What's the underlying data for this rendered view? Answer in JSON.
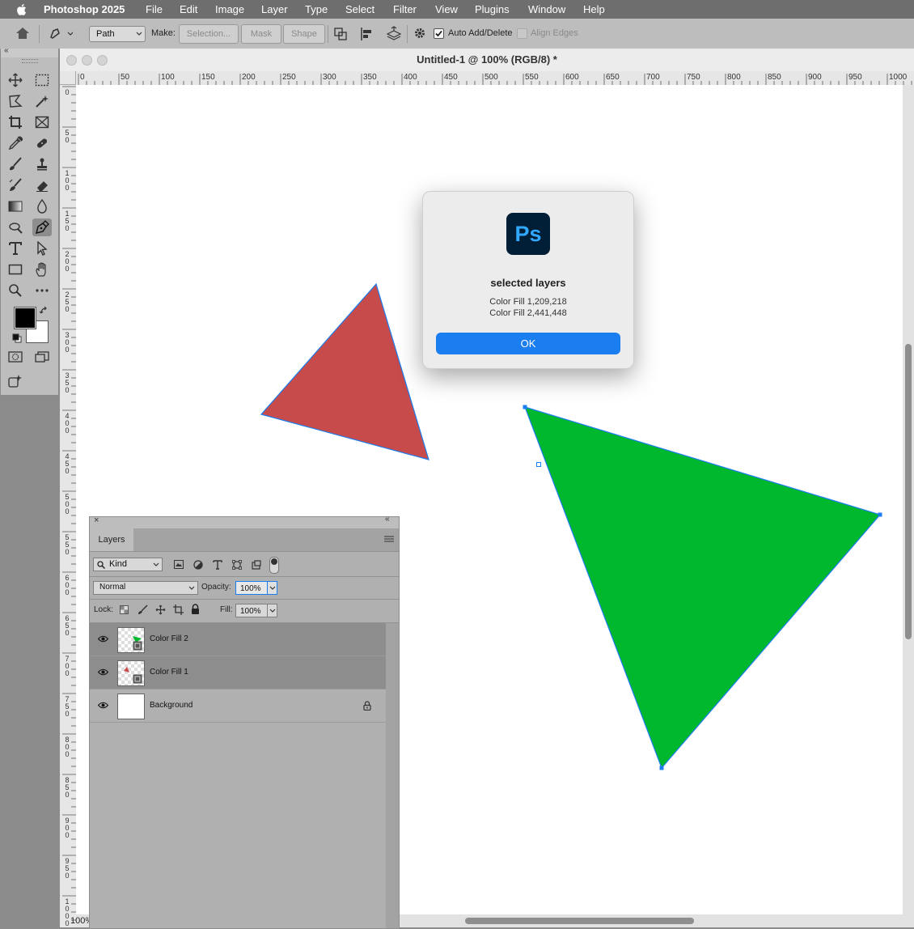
{
  "menubar": {
    "app_name": "Photoshop 2025",
    "items": [
      "File",
      "Edit",
      "Image",
      "Layer",
      "Type",
      "Select",
      "Filter",
      "View",
      "Plugins",
      "Window",
      "Help"
    ]
  },
  "options": {
    "mode_value": "Path",
    "make_label": "Make:",
    "selection_button": "Selection...",
    "mask_button": "Mask",
    "shape_button": "Shape",
    "auto_add_delete": "Auto Add/Delete",
    "auto_add_delete_checked": true,
    "align_edges": "Align Edges"
  },
  "document": {
    "title": "Untitled-1 @ 100% (RGB/8) *",
    "zoom": "100%",
    "hruler_labels": [
      "0",
      "50",
      "100",
      "150",
      "200",
      "250",
      "300",
      "350",
      "400",
      "450",
      "500",
      "550",
      "600",
      "650",
      "700",
      "750",
      "800",
      "850",
      "900",
      "950",
      "1000"
    ],
    "vruler_labels": [
      "0",
      "50",
      "100",
      "150",
      "200",
      "250",
      "300",
      "350",
      "400",
      "450",
      "500",
      "550",
      "600",
      "650",
      "700",
      "750",
      "800",
      "850",
      "900",
      "950",
      "1000"
    ]
  },
  "shapes": {
    "red_color": "#c84b4b",
    "green_color": "#00b82e",
    "path_color": "#1a7df0"
  },
  "dialog": {
    "title": "selected layers",
    "line1": "Color Fill 1,209,218",
    "line2": "Color Fill 2,441,448",
    "ok_label": "OK",
    "logo_text": "Ps"
  },
  "layers_panel": {
    "tab_label": "Layers",
    "kind_filter": "Kind",
    "blend_mode": "Normal",
    "opacity_label": "Opacity:",
    "opacity_value": "100%",
    "lock_label": "Lock:",
    "fill_label": "Fill:",
    "fill_value": "100%",
    "layers": [
      {
        "name": "Color Fill 2",
        "selected": true
      },
      {
        "name": "Color Fill 1",
        "selected": true
      },
      {
        "name": "Background",
        "selected": false
      }
    ]
  }
}
